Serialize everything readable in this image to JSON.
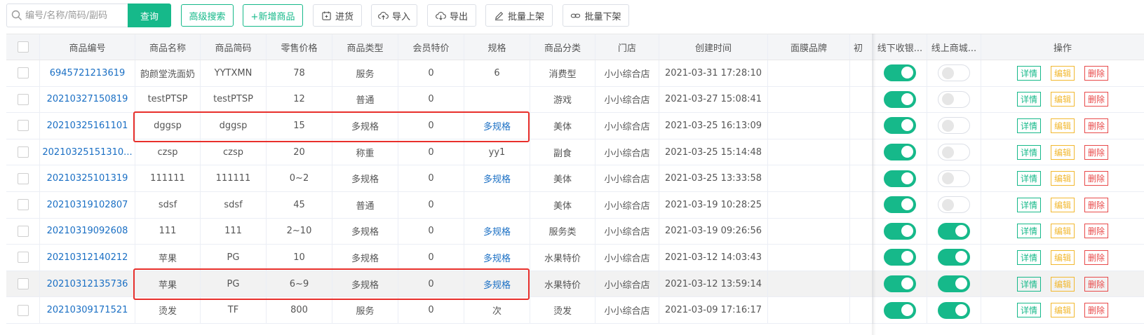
{
  "toolbar": {
    "search_placeholder": "编号/名称/简码/副码",
    "query_label": "查询",
    "advanced_label": "高级搜索",
    "add_label": "+新增商品",
    "purchase_label": "进货",
    "import_label": "导入",
    "export_label": "导出",
    "batch_on_label": "批量上架",
    "batch_off_label": "批量下架"
  },
  "columns": [
    "商品编号",
    "商品名称",
    "商品简码",
    "零售价格",
    "商品类型",
    "会员特价",
    "规格",
    "商品分类",
    "门店",
    "创建时间",
    "面膜品牌",
    "初",
    "线下收银...",
    "线上商城...",
    "操作"
  ],
  "op_labels": {
    "detail": "详情",
    "edit": "编辑",
    "delete": "删除"
  },
  "rows": [
    {
      "code": "6945721213619",
      "name": "韵颜堂洗面奶",
      "short": "YYTXMN",
      "price": "78",
      "type": "服务",
      "member": "0",
      "spec": "6",
      "spec_link": false,
      "category": "消费型",
      "store": "小小综合店",
      "created": "2021-03-31 17:28:10",
      "offline": true,
      "online": false
    },
    {
      "code": "20210327150819",
      "name": "testPTSP",
      "short": "testPTSP",
      "price": "12",
      "type": "普通",
      "member": "0",
      "spec": "",
      "spec_link": false,
      "category": "游戏",
      "store": "小小综合店",
      "created": "2021-03-27 15:08:41",
      "offline": true,
      "online": false
    },
    {
      "code": "20210325161101",
      "name": "dggsp",
      "short": "dggsp",
      "price": "15",
      "type": "多规格",
      "member": "0",
      "spec": "多规格",
      "spec_link": true,
      "category": "美体",
      "store": "小小综合店",
      "created": "2021-03-25 16:13:09",
      "offline": true,
      "online": false
    },
    {
      "code": "20210325151310...",
      "name": "czsp",
      "short": "czsp",
      "price": "20",
      "type": "称重",
      "member": "0",
      "spec": "yy1",
      "spec_link": false,
      "category": "副食",
      "store": "小小综合店",
      "created": "2021-03-25 15:14:48",
      "offline": true,
      "online": false
    },
    {
      "code": "20210325101319",
      "name": "111111",
      "short": "111111",
      "price": "0~2",
      "type": "多规格",
      "member": "0",
      "spec": "多规格",
      "spec_link": true,
      "category": "美体",
      "store": "小小综合店",
      "created": "2021-03-25 13:33:58",
      "offline": true,
      "online": false
    },
    {
      "code": "20210319102807",
      "name": "sdsf",
      "short": "sdsf",
      "price": "45",
      "type": "普通",
      "member": "0",
      "spec": "",
      "spec_link": false,
      "category": "美体",
      "store": "小小综合店",
      "created": "2021-03-19 10:28:25",
      "offline": true,
      "online": false
    },
    {
      "code": "20210319092608",
      "name": "111",
      "short": "111",
      "price": "2~10",
      "type": "多规格",
      "member": "0",
      "spec": "多规格",
      "spec_link": true,
      "category": "服务类",
      "store": "小小综合店",
      "created": "2021-03-19 09:26:56",
      "offline": true,
      "online": true
    },
    {
      "code": "20210312140212",
      "name": "苹果",
      "short": "PG",
      "price": "10",
      "type": "多规格",
      "member": "0",
      "spec": "多规格",
      "spec_link": true,
      "category": "水果特价",
      "store": "小小综合店",
      "created": "2021-03-12 14:03:43",
      "offline": true,
      "online": true
    },
    {
      "code": "20210312135736",
      "name": "苹果",
      "short": "PG",
      "price": "6~9",
      "type": "多规格",
      "member": "0",
      "spec": "多规格",
      "spec_link": true,
      "category": "水果特价",
      "store": "小小综合店",
      "created": "2021-03-12 13:59:14",
      "offline": true,
      "online": true,
      "highlight": true
    },
    {
      "code": "20210309171521",
      "name": "烫发",
      "short": "TF",
      "price": "800",
      "type": "服务",
      "member": "0",
      "spec": "次",
      "spec_link": false,
      "category": "烫发",
      "store": "小小综合店",
      "created": "2021-03-09 17:16:17",
      "offline": true,
      "online": true
    }
  ],
  "colors": {
    "accent": "#16b98a",
    "link": "#1a6fc4",
    "edit": "#f2b830",
    "delete": "#e84a4a",
    "highlight_box": "#e8302c"
  }
}
